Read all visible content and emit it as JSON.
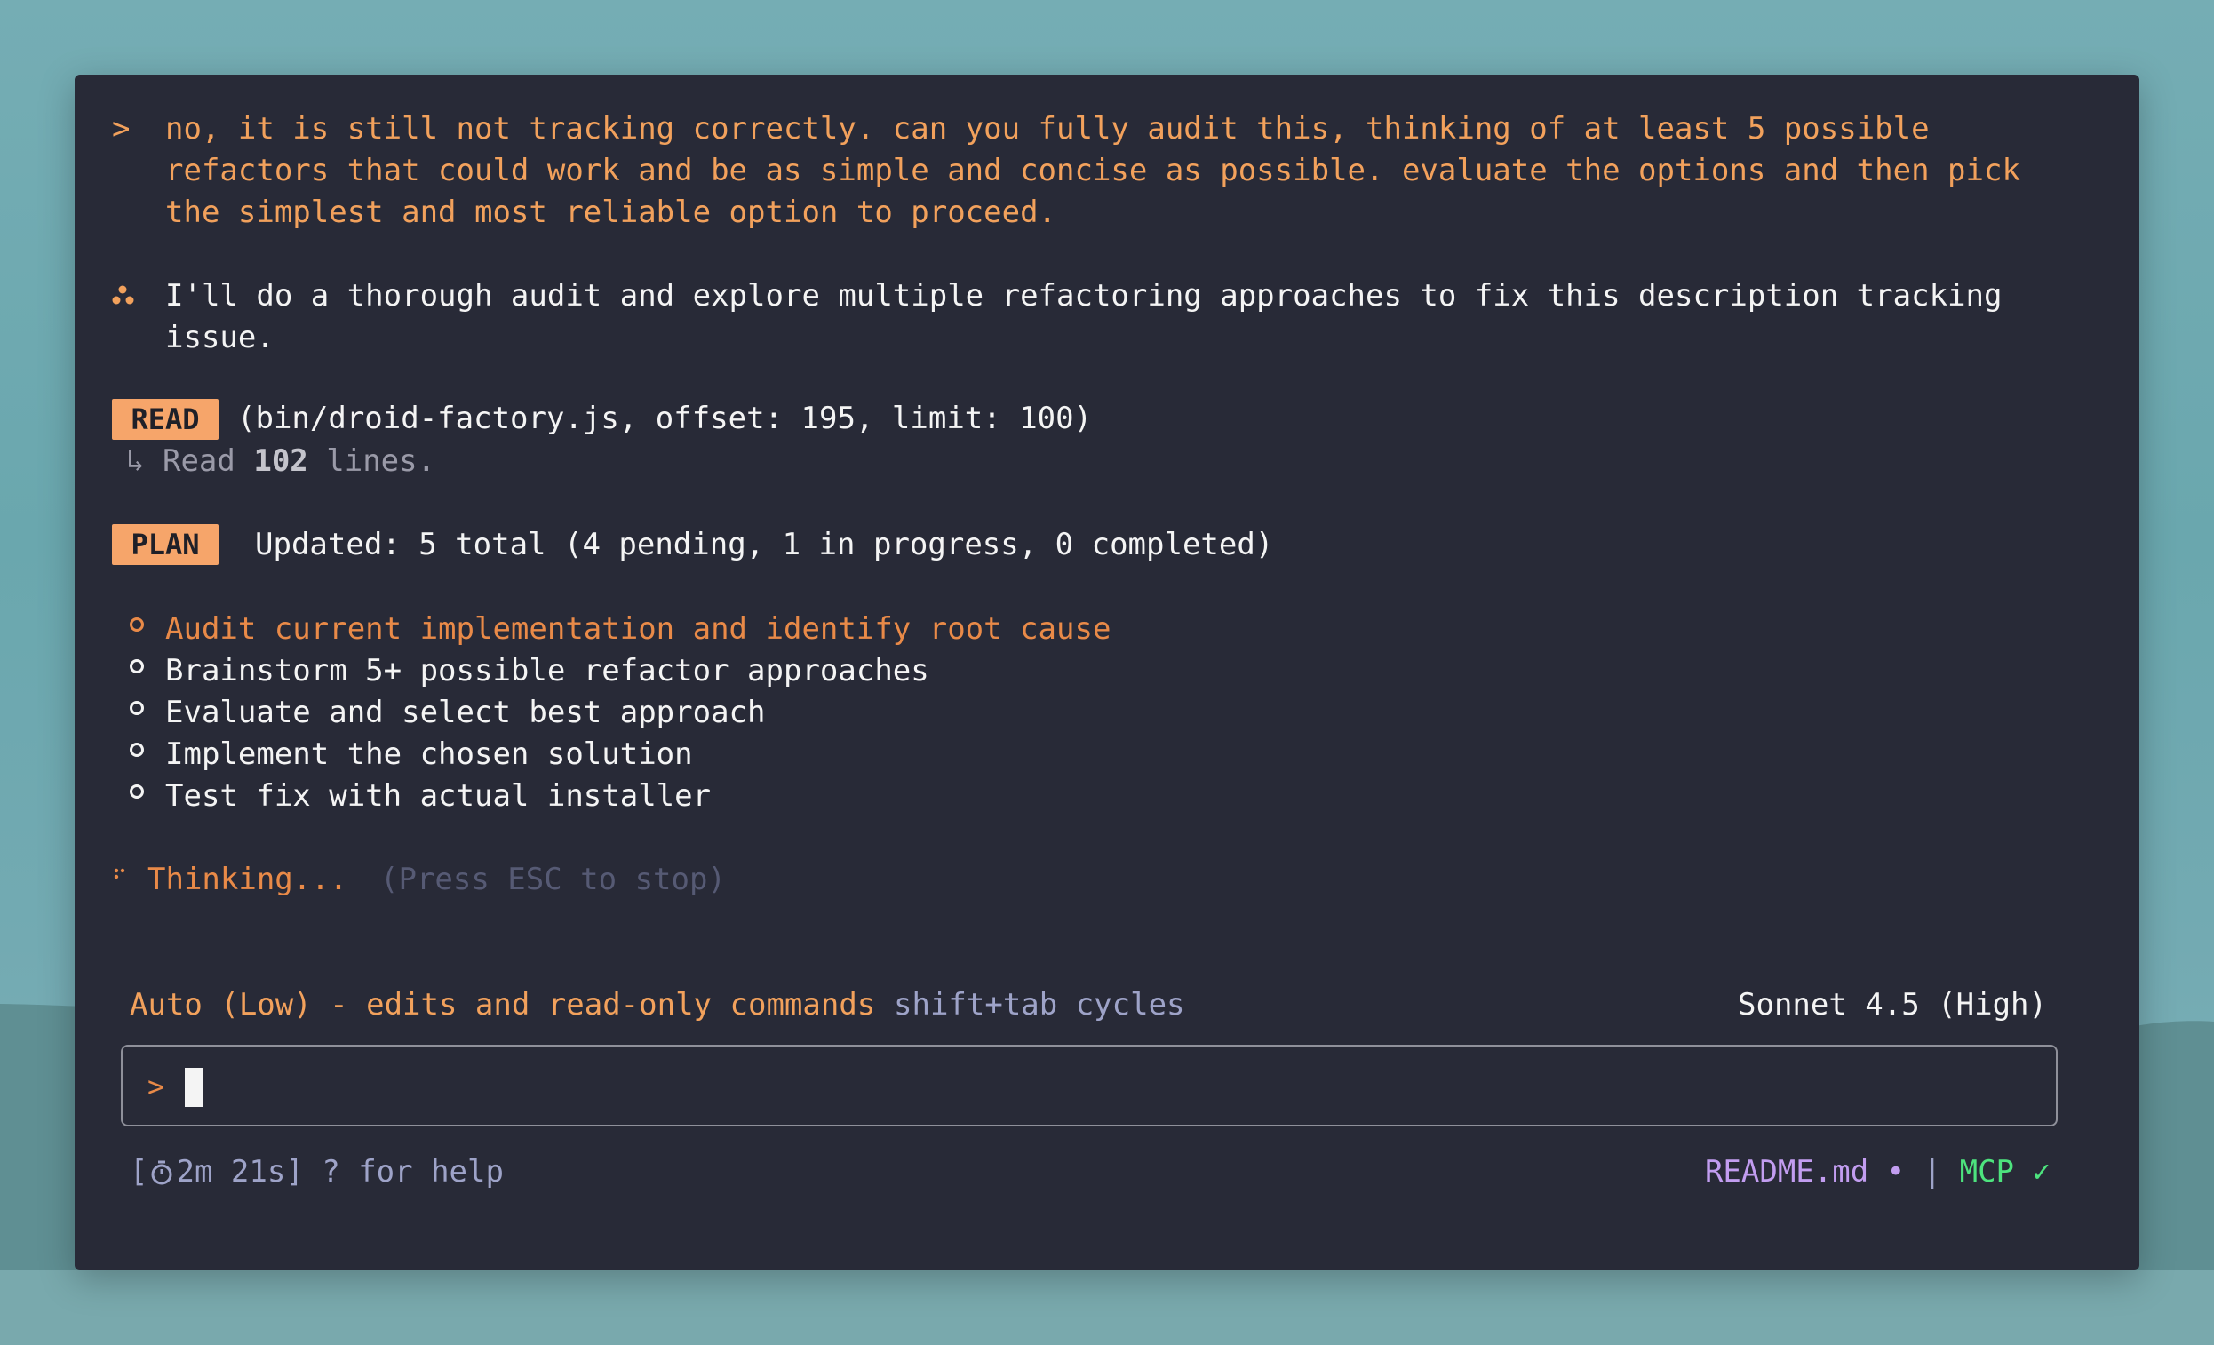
{
  "conversation": {
    "user_prompt_symbol": ">",
    "user_message_lines": [
      "no, it is still not tracking correctly. can you fully audit this, thinking of at least 5 possible",
      "refactors that could work and be as simple and concise as possible. evaluate the options and then pick",
      "the simplest and most reliable option to proceed."
    ],
    "assistant_message_lines": [
      "I'll do a thorough audit and explore multiple refactoring approaches to fix this description tracking",
      "issue."
    ]
  },
  "read_tool": {
    "tag": "READ",
    "args": "(bin/droid-factory.js, offset: 195, limit: 100)",
    "result_arrow": "↳",
    "result_prefix": "Read",
    "result_count": "102",
    "result_suffix": "lines."
  },
  "plan_tool": {
    "tag": "PLAN",
    "summary": "Updated: 5 total (4 pending, 1 in progress, 0 completed)",
    "items": [
      {
        "label": "Audit current implementation and identify root cause",
        "status": "in_progress"
      },
      {
        "label": "Brainstorm 5+ possible refactor approaches",
        "status": "pending"
      },
      {
        "label": "Evaluate and select best approach",
        "status": "pending"
      },
      {
        "label": "Implement the chosen solution",
        "status": "pending"
      },
      {
        "label": "Test fix with actual installer",
        "status": "pending"
      }
    ]
  },
  "thinking": {
    "label": "Thinking...",
    "hint": "(Press ESC to stop)"
  },
  "mode_bar": {
    "mode": "Auto (Low) - edits and read-only commands",
    "cycle_hint": "shift+tab cycles",
    "model": "Sonnet 4.5 (High)"
  },
  "input": {
    "prompt_symbol": ">",
    "value": ""
  },
  "status_bar": {
    "timer_open": "[",
    "timer": "2m 21s]",
    "help": "? for help",
    "file": "README.md",
    "file_dot": "•",
    "separator": "|",
    "mcp": "MCP",
    "mcp_check": "✓"
  },
  "colors": {
    "terminal_bg": "#282a37",
    "accent_orange": "#f2a15c",
    "tag_bg": "#f6a56a",
    "mcp_green": "#4de37e",
    "readme_purple": "#c29df0"
  }
}
